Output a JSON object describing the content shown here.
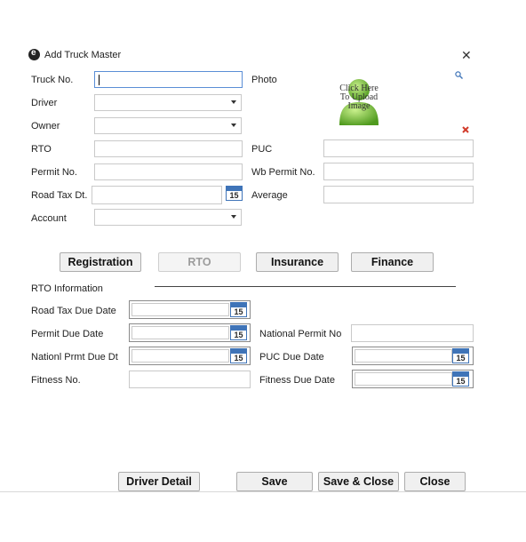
{
  "window": {
    "title": "Add Truck Master",
    "close_glyph": "✕"
  },
  "fields": {
    "truck_no": "Truck No.",
    "driver": "Driver",
    "owner": "Owner",
    "rto": "RTO",
    "permit_no": "Permit No.",
    "road_tax_dt": "Road Tax Dt.",
    "account": "Account",
    "photo": "Photo",
    "puc": "PUC",
    "wb_permit_no": "Wb Permit No.",
    "average": "Average"
  },
  "photo": {
    "upload_text": "Click Here To Upload Image"
  },
  "calendar_day": "15",
  "tabs": [
    {
      "label": "Registration",
      "enabled": true
    },
    {
      "label": "RTO",
      "enabled": false
    },
    {
      "label": "Insurance",
      "enabled": true
    },
    {
      "label": "Finance",
      "enabled": true
    }
  ],
  "rto_section": {
    "heading": "RTO Information",
    "road_tax_due_date": "Road Tax Due Date",
    "permit_due_date": "Permit Due Date",
    "nationl_prmt_due_dt": "Nationl Prmt Due Dt",
    "fitness_no": "Fitness No.",
    "national_permit_no": "National Permit No",
    "puc_due_date": "PUC Due Date",
    "fitness_due_date": "Fitness Due Date"
  },
  "footer_buttons": {
    "driver_detail": "Driver Detail",
    "save": "Save",
    "save_close": "Save & Close",
    "close": "Close"
  },
  "colors": {
    "accent": "#3f74b8",
    "focus_border": "#5a8ed6",
    "icon_green": "#7fc34a",
    "delete_red": "#d23b2b"
  }
}
